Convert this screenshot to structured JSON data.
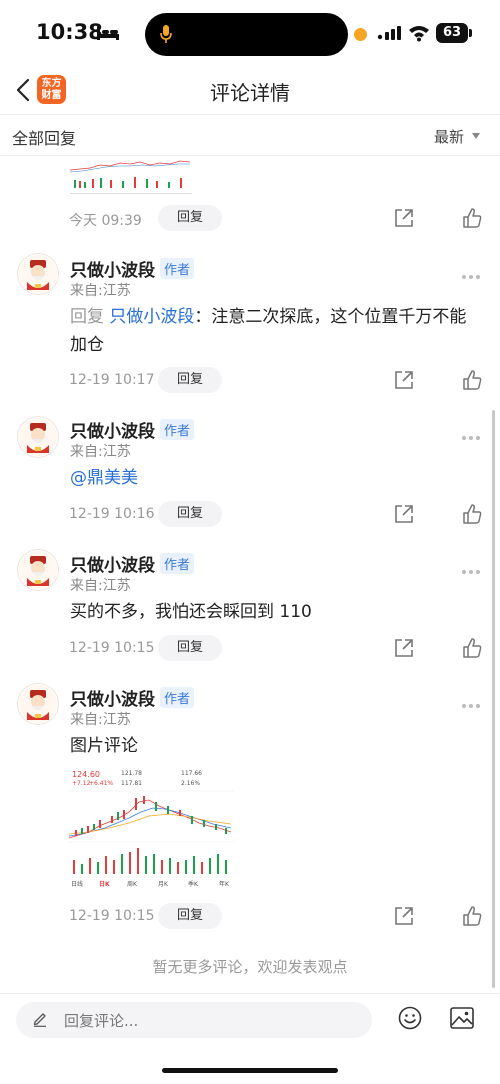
{
  "status_bar": {
    "time": "10:38",
    "battery": "63"
  },
  "nav": {
    "title": "评论详情",
    "logo_line1": "东方",
    "logo_line2": "财富"
  },
  "filter": {
    "all_replies": "全部回复",
    "sort": "最新"
  },
  "top_partial": {
    "time": "今天 09:39",
    "reply_label": "回复"
  },
  "comments": [
    {
      "author": "只做小波段",
      "badge": "作者",
      "from": "来自:江苏",
      "reply_prefix": "回复",
      "reply_to": "只做小波段",
      "text": "：注意二次探底，这个位置千万不能加仓",
      "time": "12-19 10:17",
      "reply_label": "回复"
    },
    {
      "author": "只做小波段",
      "badge": "作者",
      "from": "来自:江苏",
      "mention": "@鼎美美",
      "time": "12-19 10:16",
      "reply_label": "回复"
    },
    {
      "author": "只做小波段",
      "badge": "作者",
      "from": "来自:江苏",
      "text": "买的不多，我怕还会睬回到 110",
      "time": "12-19 10:15",
      "reply_label": "回复"
    },
    {
      "author": "只做小波段",
      "badge": "作者",
      "from": "来自:江苏",
      "text": "图片评论",
      "time": "12-19 10:15",
      "reply_label": "回复"
    }
  ],
  "stock_image": {
    "price": "124.60",
    "change": "+7.12",
    "pct": "+6.41%",
    "high": "121.78",
    "low": "117.81",
    "vol_ratio": "117.66",
    "turnover": "2.16%",
    "tabs": [
      "日K",
      "周K",
      "月K",
      "季K",
      "年K"
    ],
    "first_tab": "日线"
  },
  "footer": {
    "no_more": "暂无更多评论，欢迎发表观点"
  },
  "input": {
    "placeholder": "回复评论..."
  },
  "colors": {
    "accent": "#2a6fd6",
    "brand": "#f26522",
    "up": "#e33c3c",
    "down": "#1aa34a"
  }
}
